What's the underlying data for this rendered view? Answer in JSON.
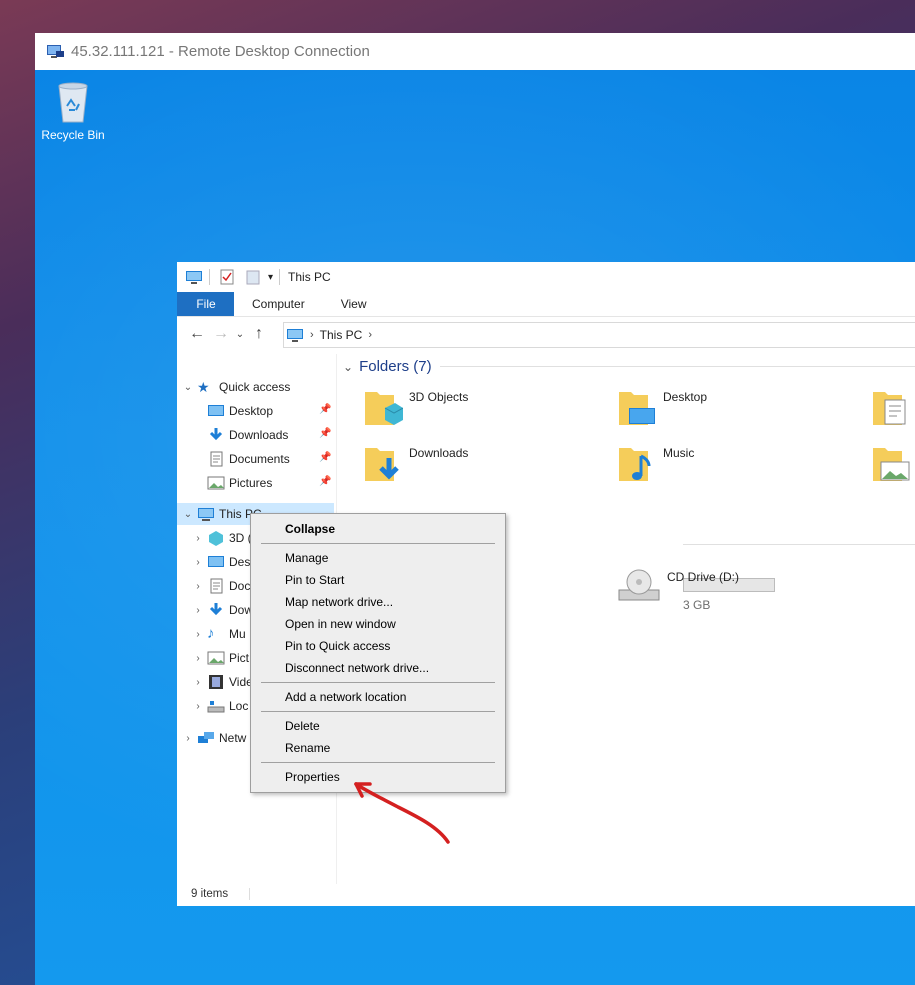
{
  "rdp": {
    "title": "45.32.111.121 - Remote Desktop Connection",
    "icon": "remote-desktop-icon"
  },
  "desktop": {
    "recycle_bin_label": "Recycle Bin",
    "background_color": "#0f8fea"
  },
  "explorer": {
    "window_title": "This PC",
    "tabs": [
      {
        "label": "File"
      },
      {
        "label": "Computer"
      },
      {
        "label": "View"
      }
    ],
    "address": {
      "segments": [
        "This PC"
      ]
    },
    "nav_pane": {
      "quick_access": "Quick access",
      "quick_items": [
        "Desktop",
        "Downloads",
        "Documents",
        "Pictures"
      ],
      "this_pc": "This PC",
      "this_pc_children_partial": [
        "3D (",
        "Des",
        "Doc",
        "Dow",
        "Mu",
        "Pict",
        "Vide",
        "Loc"
      ],
      "network_partial": "Netw"
    },
    "content": {
      "folders_header": "Folders (7)",
      "folders": [
        "3D Objects",
        "Desktop",
        "Downloads",
        "Music"
      ],
      "drive_partial_size": "3 GB",
      "cd_drive": "CD Drive (D:)"
    },
    "status": {
      "items": "9 items"
    },
    "accent_color": "#1e6fc2"
  },
  "context_menu": {
    "items": [
      {
        "label": "Collapse",
        "bold": true
      },
      {
        "label": "Manage"
      },
      {
        "label": "Pin to Start"
      },
      {
        "label": "Map network drive..."
      },
      {
        "label": "Open in new window"
      },
      {
        "label": "Pin to Quick access"
      },
      {
        "label": "Disconnect network drive..."
      },
      {
        "label": "Add a network location"
      },
      {
        "label": "Delete"
      },
      {
        "label": "Rename"
      },
      {
        "label": "Properties"
      }
    ],
    "annotation_color": "#d42020"
  }
}
